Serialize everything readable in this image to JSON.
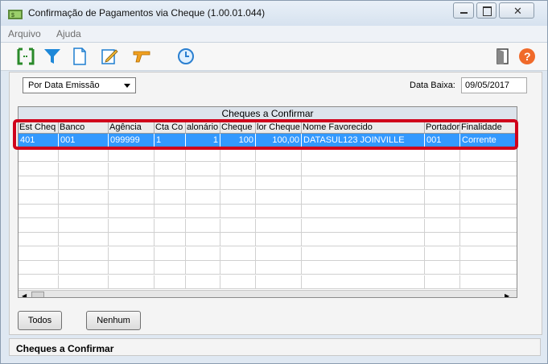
{
  "window": {
    "title": "Confirmação de Pagamentos via Cheque (1.00.01.044)"
  },
  "menu": {
    "items": [
      "Arquivo",
      "Ajuda"
    ]
  },
  "toolbar": {
    "icons": [
      "bracket-select-icon",
      "filter-icon",
      "new-document-icon",
      "edit-icon",
      "gun-icon",
      "clock-icon",
      "exit-door-icon",
      "help-icon"
    ]
  },
  "filters": {
    "sort_value": "Por Data Emissão",
    "data_baixa_label": "Data Baixa:",
    "data_baixa_value": "09/05/2017"
  },
  "grid": {
    "caption": "Cheques a Confirmar",
    "columns": [
      "Est Cheq",
      "Banco",
      "Agência",
      "Cta Co",
      "alonário",
      "Cheque",
      "lor Cheque",
      "Nome Favorecido",
      "Portador",
      "Finalidade"
    ],
    "rows": [
      [
        "401",
        "001",
        "099999",
        "1",
        "1",
        "100",
        "100,00",
        "DATASUL123 JOINVILLE",
        "001",
        "Corrente"
      ]
    ]
  },
  "buttons": {
    "todos": "Todos",
    "nenhum": "Nenhum"
  },
  "status": {
    "text": "Cheques a Confirmar"
  },
  "colors": {
    "selection": "#3399ff",
    "highlight": "#d0021b"
  }
}
